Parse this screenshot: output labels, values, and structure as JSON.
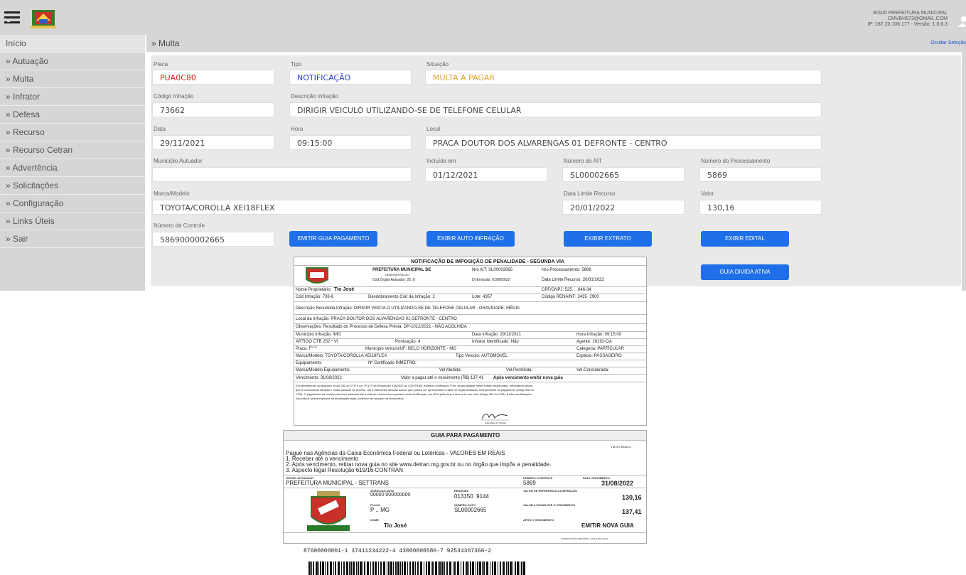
{
  "header": {
    "user_line1": "90100 PREFEITURA MUNICIPAL",
    "user_line2": "CMVBH573@GMAIL.COM",
    "user_line3": "IP: 187.20.106.177 - Versão: 1.0.6.3"
  },
  "sidebar": {
    "items": [
      {
        "label": "Início"
      },
      {
        "label": "» Autuação"
      },
      {
        "label": "» Multa"
      },
      {
        "label": "» Infrator"
      },
      {
        "label": "» Defesa"
      },
      {
        "label": "» Recurso"
      },
      {
        "label": "» Recurso Cetran"
      },
      {
        "label": "» Advertência"
      },
      {
        "label": "» Solicitações"
      },
      {
        "label": "» Configuração"
      },
      {
        "label": "» Links Úteis"
      },
      {
        "label": "» Sair"
      }
    ]
  },
  "main": {
    "title": "» Multa",
    "hide_selection": "Ocultar Seleção"
  },
  "form": {
    "placa": {
      "label": "Placa",
      "value": "PUA0C80"
    },
    "tipo": {
      "label": "Tipo",
      "value": "NOTIFICAÇÃO"
    },
    "situacao": {
      "label": "Situação",
      "value": "MULTA A PAGAR"
    },
    "codigo_infracao": {
      "label": "Código Infração",
      "value": "73662"
    },
    "descricao_infracao": {
      "label": "Descrição Infração",
      "value": "DIRIGIR VEICULO UTILIZANDO-SE DE TELEFONE CELULAR"
    },
    "data": {
      "label": "Data",
      "value": "29/11/2021"
    },
    "hora": {
      "label": "Hora",
      "value": "09:15:00"
    },
    "local": {
      "label": "Local",
      "value": "PRACA DOUTOR DOS ALVARENGAS 01 DEFRONTE - CENTRO"
    },
    "municipio_autuador": {
      "label": "Município Autuador",
      "value": ""
    },
    "incluida_em": {
      "label": "Incluída em",
      "value": "01/12/2021"
    },
    "numero_ait": {
      "label": "Número do AIT",
      "value": "SL00002665"
    },
    "numero_processamento": {
      "label": "Número do Processamento",
      "value": "5869"
    },
    "marca_modelo": {
      "label": "Marca/Modelo",
      "value": "TOYOTA/COROLLA XEI18FLEX"
    },
    "data_limite_recurso": {
      "label": "Data Limite Recurso",
      "value": "20/01/2022"
    },
    "valor": {
      "label": "Valor",
      "value": "130,16"
    },
    "numero_controle": {
      "label": "Número de Controle",
      "value": "5869000002665"
    }
  },
  "buttons": {
    "emitir_guia": "EMITIR GUIA PAGAMENTO",
    "exibir_auto": "EXIBIR AUTO INFRAÇÃO",
    "exibir_extrato": "EXIBIR EXTRATO",
    "exibir_edital": "EXIBIR EDITAL",
    "guia_divida": "GUIA DIVIDA ATIVA"
  },
  "notificacao": {
    "title": "NOTIFICAÇÃO DE IMPOSIÇÃO DE PENALIDADE - SEGUNDA VIA",
    "org_name": "PREFEITURA MUNICIPAL DE",
    "org_sub": "DEMONSTRACAO",
    "org_code": "Cód Órgão Autuador: 25  ,0",
    "nro_ait": "Nro AIT: SL00002665",
    "nro_proc": "Nro.Processamento: 5869",
    "dt_emissao": "Dt Emissão: 01/08/2022",
    "data_limite": "Data Limite Recurso: 20/01/2022",
    "proprietario_lbl": "Nome Proprietário:",
    "proprietario": "Tio José",
    "cpf": "CPF/CNPJ: 525.  . .046-34",
    "cod_infracao": "Cód Infração: 736-6",
    "desdobramento": "Desdobramento Cód da Infração: 2",
    "lote": "Lote: 4357",
    "renainf": "Código RENAINF: 2435·  2900",
    "descricao": "Descrição Resumida Infração: DIRIGIR VEICULO UTILIZANDO-SE DE TELEFONE CELULAR - GRAVIDADE: MÉDIA",
    "local": "Local da Infração: PRACA DOUTOR DOS ALVARENGAS 01 DEFRONTE - CENTRO",
    "observacoes": "Observações: Resultado do Processo de Defesa Prévia: DP-1012/2021 - NÃO ACOLHIDA",
    "municipio": "Município Infração: /MG",
    "data_infracao": "Data Infração: 29/11/2021",
    "hora_infracao": "Hora Infração: 09:15:00",
    "artigo": "ARTIGO CTB 252 * VI",
    "pontuacao": "Pontuação: 4",
    "infrator_ident": "Infrator Identificado: Não",
    "agente": "Agente: 26192-OA",
    "placa": "Placa: F'''''''",
    "municipio_veiculo": "Município Veículo/UF: BELO HORIZONTE - MG",
    "categoria": "Categoria: PARTICULAR",
    "marca_modelo": "Marca/Modelo: TOYOTA/COROLLA XEI18FLEX",
    "tipo_veiculo": "Tipo Veículo: AUTOMOVEL",
    "especie": "Espécie: PASSAGEIRO",
    "equipamento": "Equipamento:",
    "certificado": "Nº Certificado INMETRO:",
    "marca_equip": "Marca/Modelo Equipamento:",
    "vel_medida": "Vel.Medida:",
    "vel_permitida": "Vel.Permitida:",
    "vel_considerada": "Vel.Considerada:",
    "vencimento": "Vencimento: 31/08/2022",
    "valor_pagar": "Valor a pagar até o vencimento (R$):137,41",
    "apos_venc": "Após vencimento emitir nova guia",
    "texto1": "Em atendimento ao disposto no Art.282 do CTB e Art. 9º,§ 2º da Resolução 918/2022 do CONTRAN, estamos notificando V.Sa. da penalidade neste extrato relacionada. Informamos ainda,",
    "texto2": "que a mencionada infração é multa passível de recurso, até a data limite descrita acima, que poderá ser apresentado à JARI do Órgão Autuador, independente do pagamento (Artigo 285 do",
    "texto3": "CTB). O pagamento da multa poderá ser efetuado até a data de vencimento expressa nesta Notificação, por 80% (oitenta por cento) do seu valor (Artigo 284 do CTB). A não manifestação",
    "texto4": "nos prazos acima implicará na atualização legal, podendo ser lançado na dívida ativa.",
    "assinatura": "Autoridade de Trânsito"
  },
  "guia": {
    "title": "GUIA PARA PAGAMENTO",
    "via": "VIA DO BANCO",
    "linha1": "Pague nas Agências da Caixa Econômica Federal ou Lotéricas - VALORES EM REAIS",
    "linha2": "1. Receber até o vencimento",
    "linha3": "2. Após vencimento, retirar nova guia no site www.detran.mg.gov.br ou no órgão que impôs a penalidade.",
    "linha4": "3. Aspecto legal Resolução 619/16 CONTRAN",
    "orgao_lbl": "ÓRGÃO AUTUADOR",
    "orgao": "PREFEITURA MUNICIPAL - SETTRANS",
    "num_controle_lbl": "NÚMERO CONTROLE",
    "num_controle": "5869",
    "data_venc_lbl": "DATA VENCIMENTO",
    "data_venc": "31/08/2022",
    "agencia_lbl": "AGÊNCIA/CONTA",
    "agencia": "00000 000000000",
    "renavam_lbl": "RENAVAN:",
    "renavam": "013150 .9144",
    "valor_ref_lbl": "VALOR DE REFERENCIA DA INFRAÇÃO",
    "valor_ref": "130,16",
    "placa_lbl": "PLACA",
    "placa": "P  ..   MG",
    "num_auto_lbl": "NÚMERO AUTO",
    "num_auto": "SL00002665",
    "valor_pagar_lbl": "VALOR A PAGAR ATÉ O VENCIMENTO",
    "valor_pagar": "137,41",
    "nome_lbl": "NOME",
    "nome": "Tio José",
    "apos_lbl": "APÓS O VENCIMENTO",
    "apos": "EMITIR NOVA GUIA",
    "autenticacao": "AUTENTICAÇÃO MECÂNICA - FICHA DE CAIXA"
  },
  "barcode": {
    "digits": "87600000001-1 37411234222-4 43000000586-7 92534307366-2"
  },
  "colors": {
    "accent_button": "#1f6fe8",
    "placa_red": "#d21a1a",
    "tipo_blue": "#2b3fd0",
    "situacao_orange": "#e0a12e"
  }
}
